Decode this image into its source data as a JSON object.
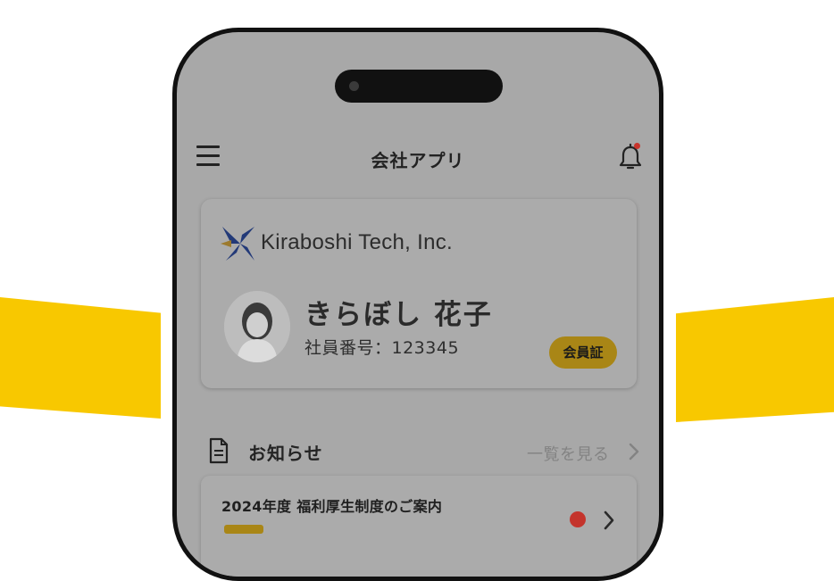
{
  "app": {
    "title": "会社アプリ"
  },
  "header": {
    "menu_icon": "hamburger-menu-icon",
    "notification_icon": "bell-icon",
    "has_unread_notification": true
  },
  "member_card": {
    "company": "Kiraboshi Tech, Inc.",
    "name": "きらぼし 花子",
    "employee_number": "社員番号：123345",
    "badge_label": "会員証"
  },
  "news": {
    "section_title": "お知らせ",
    "view_all_label": "一覧を見る",
    "items": [
      {
        "title": "2024年度 福利厚生制度のご案内",
        "unread": true
      }
    ]
  },
  "colors": {
    "accent_yellow": "#f8c800",
    "badge_gold": "#a98616",
    "unread_red": "#c4342c",
    "overlay_gray": "#a8a8a8"
  }
}
